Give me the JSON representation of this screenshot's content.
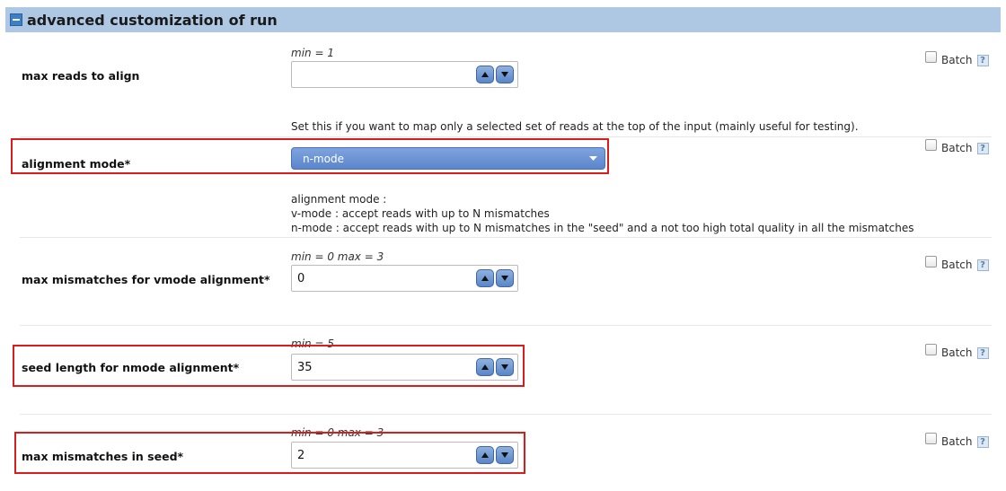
{
  "section": {
    "title": "advanced customization of run"
  },
  "batch_label": "Batch",
  "help_icon": "?",
  "fields": {
    "max_reads": {
      "label": "max reads to align",
      "hint": "min = 1",
      "value": "",
      "help": "Set this if you want to map only a selected set of reads at the top of the input (mainly useful for testing)."
    },
    "alignment_mode": {
      "label": "alignment mode*",
      "value": "n-mode",
      "help_lines": [
        "alignment mode :",
        "v-mode : accept reads with up to N mismatches",
        "n-mode : accept reads with up to N mismatches in the \"seed\" and a not too high total quality in all the mismatches"
      ]
    },
    "max_mismatches_vmode": {
      "label": "max mismatches for vmode alignment*",
      "hint": "min = 0 max = 3",
      "value": "0"
    },
    "seed_length": {
      "label": "seed length for nmode alignment*",
      "hint": "min = 5",
      "value": "35"
    },
    "max_mismatches_seed": {
      "label": "max mismatches in seed*",
      "hint": "min = 0 max = 3",
      "value": "2"
    }
  },
  "colors": {
    "header_bg": "#aec8e4",
    "highlight": "#d91c1c",
    "select_bg": "#5b85cc"
  }
}
